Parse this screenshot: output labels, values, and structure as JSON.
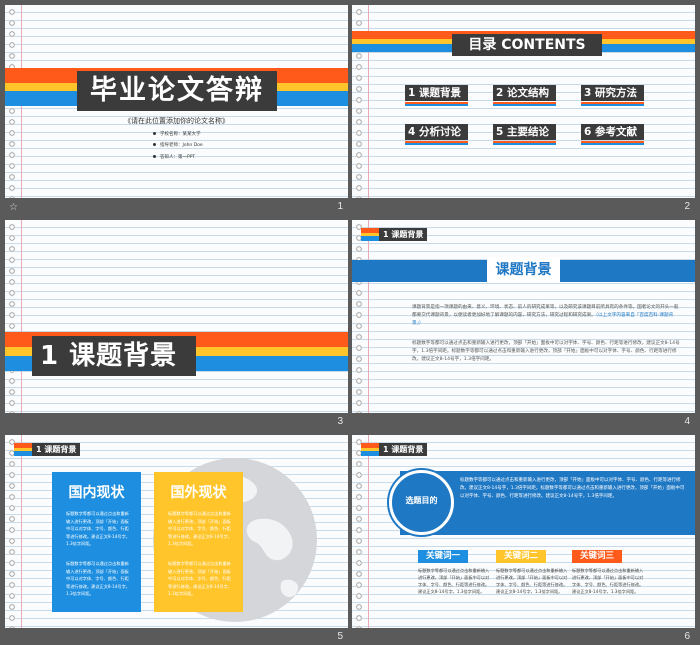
{
  "slides": [
    {
      "number": "1",
      "title": "毕业论文答辩",
      "subtitle": "《请在此位置添加你的论文名称》",
      "info": [
        "学校名称：某某大学",
        "指导老师：John  Doe",
        "答辩人：第一PPT"
      ]
    },
    {
      "number": "2",
      "title": "目录 CONTENTS",
      "items": [
        "1 课题背景",
        "2 论文结构",
        "3 研究方法",
        "4 分析讨论",
        "5 主要结论",
        "6 参考文献"
      ]
    },
    {
      "number": "3",
      "title": "1 课题背景"
    },
    {
      "number": "4",
      "tag": "1 课题背景",
      "title": "课题背景",
      "para1": "课题背景是指一项课题的由来、意义、环境、状态、前人的研究成果等，以及研究该课题目前所具有的条件等。国者论文的开头一般都要交代课题背景，以便读者更加好地了解课题的内容，研究方法，研究过程和研究成果。",
      "para1_highlight": "（以上文字内容来自「百度百科-课题背景」）",
      "para2": "标题数字等都可以通过点击和重新输入进行更改，顶部「开始」面板中可以对字体、字号、颜色、行距等进行修改。建议正文8-14号字，1.3倍字间距。标题数字等都可以通过点击和重新输入进行更改，顶部「开始」面板中可以对字体、字号、颜色、行距等进行修改。建议正文8-14号字，1.3倍字间距。"
    },
    {
      "number": "5",
      "tag": "1 课题背景",
      "panels": [
        {
          "title": "国内现状",
          "text1": "标题数字等都可以通过点击和重新输入进行更改，顶部「开始」面板中可以对字体、字号、颜色、行距等进行修改。建议正文8-14号字，1.3倍字间距。",
          "text2": "标题数字等都可以通过点击和重新输入进行更改，顶部「开始」面板中可以对字体、字号、颜色、行距等进行修改。建议正文8-14号字，1.3倍字间距。"
        },
        {
          "title": "国外现状",
          "text1": "标题数字等都可以通过点击和重新输入进行更改，顶部「开始」面板中可以对字体、字号、颜色、行距等进行修改。建议正文8-14号字，1.3倍字间距。",
          "text2": "标题数字等都可以通过点击和重新输入进行更改，顶部「开始」面板中可以对字体、字号、颜色、行距等进行修改。建议正文8-14号字，1.3倍字间距。"
        }
      ]
    },
    {
      "number": "6",
      "tag": "1 课题背景",
      "circle_label": "选题目的",
      "band_text": "标题数字等都可以通过点击和重新输入进行更改，顶部「开始」面板中可以对字体、字号、颜色、行距等进行修改。建议正文8-14号字，1.3倍字间距。标题数字等都可以通过点击和重新输入进行更改，顶部「开始」面板中可以对字体、字号、颜色、行距等进行修改。建议正文8-14号字，1.3倍字间距。",
      "keywords": [
        {
          "label": "关键词一",
          "color": "#1e8fe0",
          "text": "标题数字等都可以通过点击和重新输入进行更改，顶部「开始」面板中可以对字体、字号、颜色、行距等进行修改。建议正文8-14号字，1.3倍字间距。"
        },
        {
          "label": "关键词二",
          "color": "#ffc52a",
          "text": "标题数字等都可以通过点击和重新输入进行更改，顶部「开始」面板中可以对字体、字号、颜色、行距等进行修改。建议正文8-14号字，1.3倍字间距。"
        },
        {
          "label": "关键词三",
          "color": "#ff5a1a",
          "text": "标题数字等都可以通过点击和重新输入进行更改，顶部「开始」面板中可以对字体、字号、颜色、行距等进行修改。建议正文8-14号字，1.3倍字间距。"
        }
      ]
    }
  ],
  "footer_icon": "star-icon",
  "colors": {
    "orange": "#ff5a1a",
    "yellow": "#ffc52a",
    "blue": "#1e8fe0",
    "dark": "#3b3b3b",
    "navy_blue": "#1f78c4",
    "background": "#5a5a5a"
  }
}
